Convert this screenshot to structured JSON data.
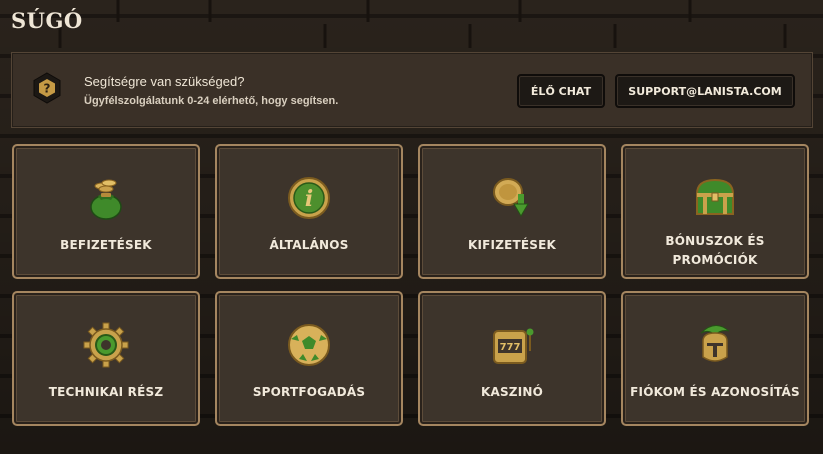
{
  "page": {
    "title": "SÚGÓ"
  },
  "help": {
    "title": "Segítségre van szükséged?",
    "subtitle": "Ügyfélszolgálatunk 0-24 elérhető, hogy segítsen.",
    "badge_glyph": "?",
    "chat_label": "ÉLŐ CHAT",
    "email_label": "SUPPORT@LANISTA.COM"
  },
  "categories": [
    {
      "label": "BEFIZETÉSEK",
      "icon": "money-bag-icon"
    },
    {
      "label": "ÁLTALÁNOS",
      "icon": "info-coin-icon"
    },
    {
      "label": "KIFIZETÉSEK",
      "icon": "coin-withdraw-icon"
    },
    {
      "label": "BÓNUSZOK ÉS PROMÓCIÓK",
      "icon": "treasure-chest-icon"
    },
    {
      "label": "TECHNIKAI RÉSZ",
      "icon": "gear-icon"
    },
    {
      "label": "SPORTFOGADÁS",
      "icon": "football-icon"
    },
    {
      "label": "KASZINÓ",
      "icon": "slot-machine-icon"
    },
    {
      "label": "FIÓKOM ÉS AZONOSÍTÁS",
      "icon": "helmet-icon"
    }
  ],
  "colors": {
    "background": "#241d17",
    "card": "#3d342b",
    "card_border": "#a58660",
    "accent_green": "#3f8a2a",
    "gold": "#c9a24b"
  }
}
